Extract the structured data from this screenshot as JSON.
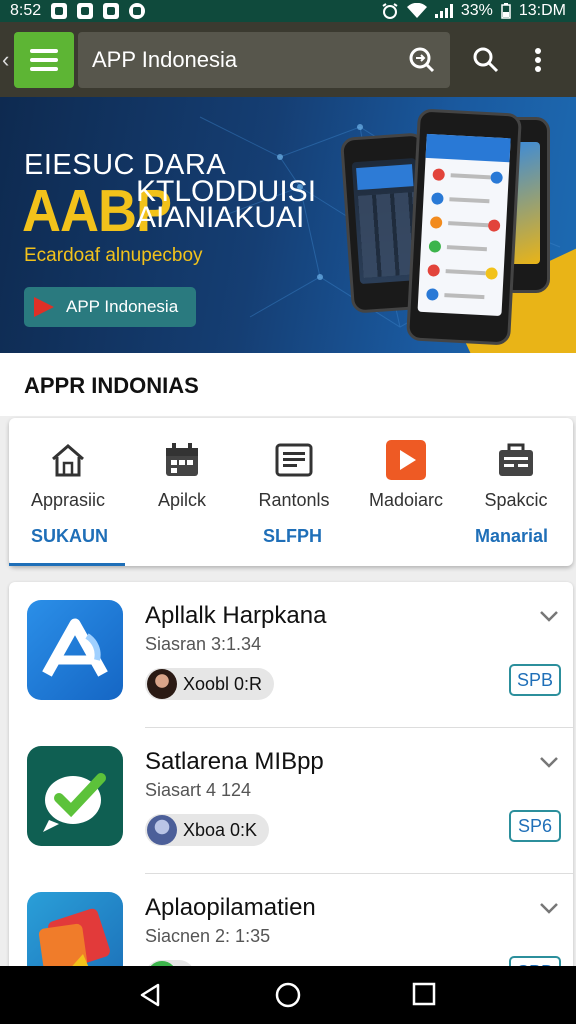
{
  "status_bar": {
    "time": "8:52",
    "battery": "33%",
    "clock": "13:DM"
  },
  "app_bar": {
    "back_icon": "chevron-left-icon",
    "menu_icon": "hamburger-menu-icon",
    "search_text": "APP Indonesia",
    "inner_icon": "search-refresh-icon",
    "search_icon": "search-icon",
    "overflow_icon": "more-vert-icon",
    "accent_color": "#5db534"
  },
  "banner": {
    "headline_small": "EIESUC DARA",
    "headline_big": "AABP",
    "headline_side": "KTLODDUISI AIANIAKUAI",
    "tagline": "Ecardoaf alnupecboy",
    "button_label": "APP Indonesia",
    "accent_color": "#f2c21b"
  },
  "section_title": "APPR INDONIAS",
  "categories": {
    "items": [
      {
        "icon": "home-icon",
        "label": "Apprasiic"
      },
      {
        "icon": "calendar-icon",
        "label": "Apilck"
      },
      {
        "icon": "news-icon",
        "label": "Rantonls"
      },
      {
        "icon": "video-play-icon",
        "label": "Madoiarc"
      },
      {
        "icon": "briefcase-icon",
        "label": "Spakcic"
      }
    ],
    "tabs": [
      {
        "label": "SUKAUN",
        "selected": true
      },
      {
        "label": "SLFPH",
        "selected": false
      },
      {
        "label": "Manarial",
        "selected": false
      }
    ]
  },
  "apps": [
    {
      "title": "Apllalk Harpkana",
      "subtitle": "Siasran 3:1.34",
      "developer": "Xoobl 0:R",
      "size": "SPB",
      "icon": "blue-a-logo-icon"
    },
    {
      "title": "Satlarena MIBpp",
      "subtitle": "Siasart 4 124",
      "developer": "Xboa 0:K",
      "size": "SP6",
      "icon": "green-check-logo-icon"
    },
    {
      "title": "Aplaopilamatien",
      "subtitle": "Siacnen 2: 1:35",
      "developer": "",
      "size": "SPB",
      "icon": "colorful-card-logo-icon"
    }
  ],
  "nav_bar": {
    "back": "back-triangle-icon",
    "home": "home-circle-icon",
    "recents": "recents-square-icon"
  }
}
